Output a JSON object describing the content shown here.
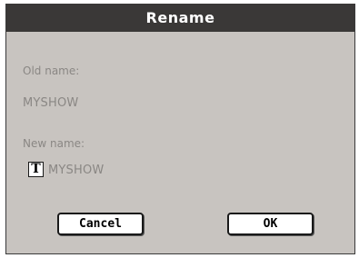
{
  "dialog": {
    "title": "Rename",
    "old_name_label": "Old name:",
    "old_name_value": "MYSHOW",
    "new_name_label": "New name:",
    "text_edit_button": "T",
    "new_name_value": "MYSHOW",
    "cancel_label": "Cancel",
    "ok_label": "OK"
  },
  "colors": {
    "titlebar": "#3a3837",
    "background": "#c8c4c0",
    "label_text": "#8a8784"
  }
}
